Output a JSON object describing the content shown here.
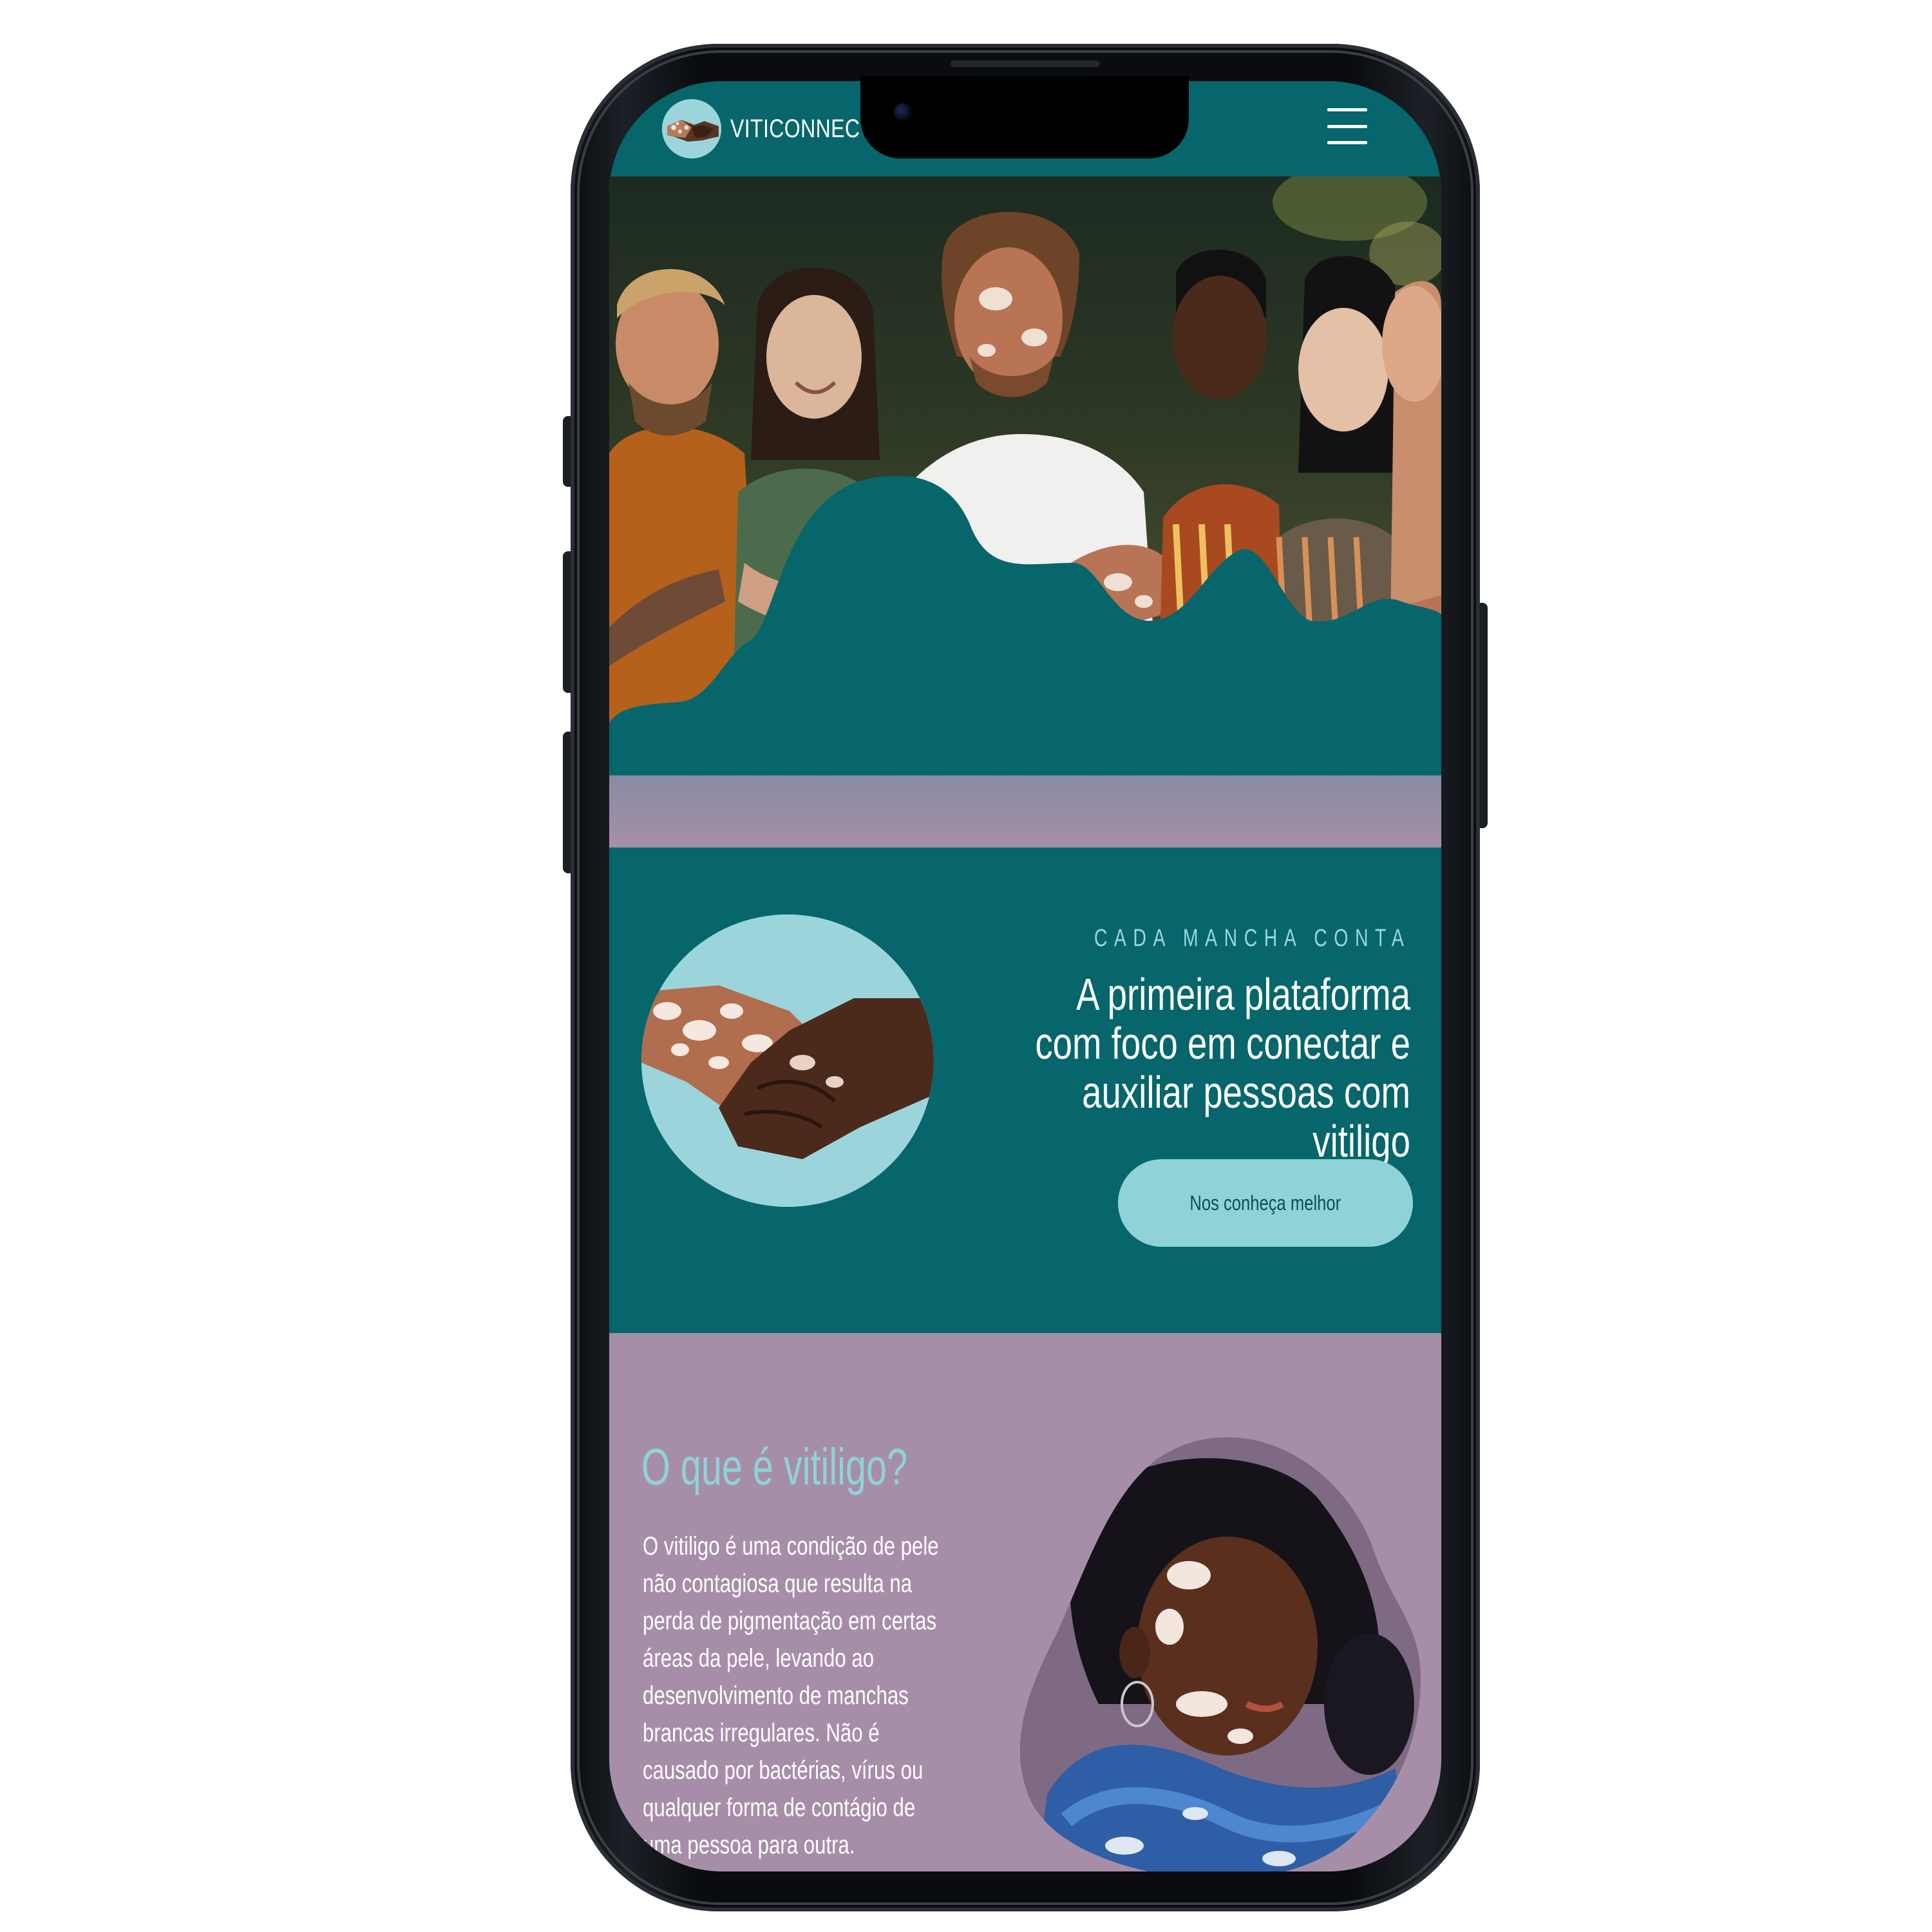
{
  "header": {
    "brand_name": "VITICONNECT",
    "logo_icon": "handshake-logo-icon",
    "menu_icon": "hamburger-menu-icon"
  },
  "hero": {
    "eyebrow": "CADA MANCHA CONTA",
    "headline": "A primeira plataforma com foco em conectar e auxiliar pessoas com vitiligo",
    "cta_label": "Nos conheça melhor"
  },
  "about": {
    "title": "O que é vitiligo?",
    "text": "O vitiligo é uma condição de pele não contagiosa que resulta na perda de pigmentação em certas áreas da pele, levando ao desenvolvimento de manchas brancas irregulares. Não é causado por bactérias, vírus ou qualquer forma de contágio de uma pessoa para outra."
  },
  "colors": {
    "primary_teal": "#06666c",
    "accent_aqua": "#8fd3d9",
    "mauve": "#a78ea8",
    "text_white": "#ffffff",
    "button_text": "#0e4f55"
  }
}
